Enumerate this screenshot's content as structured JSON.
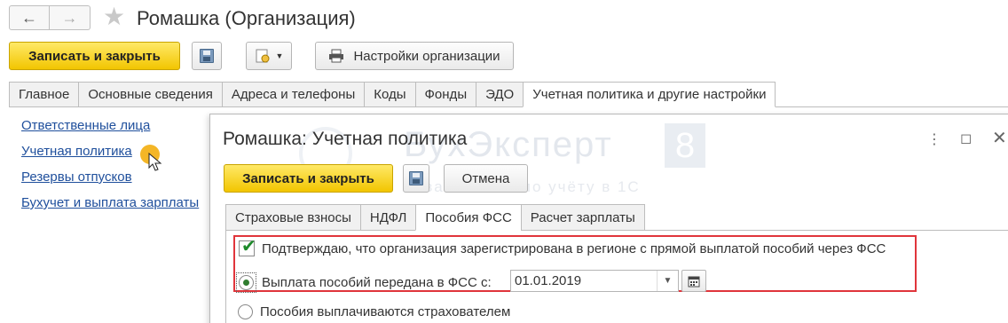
{
  "window": {
    "title": "Ромашка (Организация)",
    "back_icon": "arrow-left-icon",
    "forward_icon": "arrow-right-icon",
    "favorite_icon": "star-icon"
  },
  "toolbar": {
    "save_close_label": "Записать и закрыть",
    "settings_label": "Настройки организации"
  },
  "tabs": [
    {
      "label": "Главное"
    },
    {
      "label": "Основные сведения"
    },
    {
      "label": "Адреса и телефоны"
    },
    {
      "label": "Коды"
    },
    {
      "label": "Фонды"
    },
    {
      "label": "ЭДО"
    },
    {
      "label": "Учетная политика и другие настройки",
      "active": true
    }
  ],
  "links": [
    {
      "label": "Ответственные лица"
    },
    {
      "label": "Учетная политика"
    },
    {
      "label": "Резервы отпусков"
    },
    {
      "label": "Бухучет и выплата зарплаты"
    }
  ],
  "dialog": {
    "title": "Ромашка: Учетная политика",
    "save_close_label": "Записать и закрыть",
    "cancel_label": "Отмена",
    "tabs": [
      {
        "label": "Страховые взносы"
      },
      {
        "label": "НДФЛ"
      },
      {
        "label": "Пособия ФСС",
        "active": true
      },
      {
        "label": "Расчет зарплаты"
      }
    ],
    "confirm_checkbox_label": "Подтверждаю, что организация зарегистрирована в регионе с прямой выплатой пособий через ФСС",
    "confirm_checked": true,
    "radio_transferred_label": "Выплата пособий передана в ФСС с:",
    "transfer_date": "01.01.2019",
    "radio_insurer_label": "Пособия выплачиваются страхователем"
  },
  "watermark": {
    "text": "БухЭксперт",
    "badge": "8",
    "subtitle": "База ответов по учёту в 1С"
  },
  "colors": {
    "primary_button": "#f2c500",
    "link": "#1f4f9c",
    "highlight_box": "#e0353b",
    "check": "#1d8a2a"
  }
}
